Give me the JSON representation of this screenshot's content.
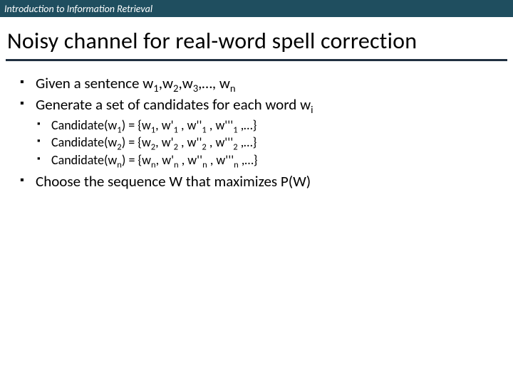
{
  "header": "Introduction to Information Retrieval",
  "title": "Noisy channel for real-word spell correction",
  "bullets": [
    {
      "pre": "Given a sentence ",
      "w": "w",
      "s1": "1",
      "s2": "2",
      "s3": "3",
      "sn": "n",
      "c": ",",
      "mid": ",…, "
    },
    {
      "pre": "Generate a set of candidates for each word ",
      "w": "w",
      "si": "i"
    },
    {
      "text": "Choose the sequence W that maximizes P(W)"
    }
  ],
  "sub": [
    {
      "pre": "Candidate(w",
      "s": "1",
      "mid": ") = {w",
      "a": ", w'",
      "b": " , w''",
      "cc": " , w'''",
      "end": " ,…}"
    },
    {
      "pre": "Candidate(w",
      "s": "2",
      "mid": ") = {w",
      "a": ", w'",
      "b": " , w''",
      "cc": " , w'''",
      "end": " ,…}"
    },
    {
      "pre": "Candidate(w",
      "s": "n",
      "mid": ") = {w",
      "a": ", w'",
      "b": " , w''",
      "cc": " , w'''",
      "end": " ,…}"
    }
  ]
}
